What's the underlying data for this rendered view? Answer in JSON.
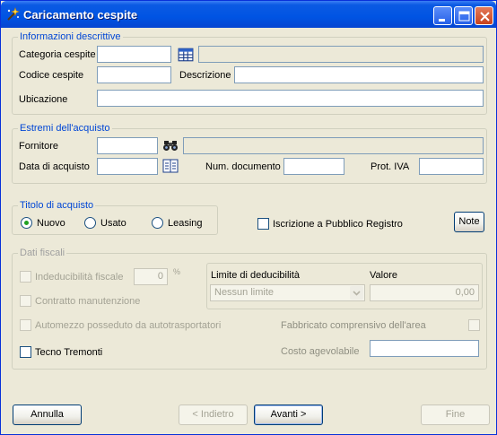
{
  "window": {
    "title": "Caricamento cespite"
  },
  "groups": {
    "informazioni": "Informazioni descrittive",
    "estremi": "Estremi dell'acquisto",
    "titolo": "Titolo di acquisto",
    "dati_fiscali": "Dati fiscali",
    "limite": "Limite di deducibilità"
  },
  "informazioni": {
    "categoria_label": "Categoria cespite",
    "categoria_value": "",
    "codice_label": "Codice cespite",
    "codice_value": "",
    "descrizione_label": "Descrizione",
    "descrizione_value": "",
    "ubicazione_label": "Ubicazione",
    "ubicazione_value": ""
  },
  "estremi": {
    "fornitore_label": "Fornitore",
    "data_label": "Data di acquisto",
    "num_doc_label": "Num. documento",
    "prot_iva_label": "Prot. IVA"
  },
  "titolo": {
    "nuovo": "Nuovo",
    "usato": "Usato",
    "leasing": "Leasing",
    "selected": "Nuovo",
    "pubblico_registro": "Iscrizione a Pubblico Registro",
    "note_button": "Note"
  },
  "fiscali": {
    "indeducibilita": "Indeducibilità fiscale",
    "indeducibilita_value": "0",
    "percent": "%",
    "contratto": "Contratto manutenzione",
    "automezzo": "Automezzo posseduto da autotrasportatori",
    "fabbricato": "Fabbricato comprensivo dell'area",
    "tecno": "Tecno Tremonti",
    "costo": "Costo agevolabile",
    "valore_label": "Valore",
    "limite_selected": "Nessun limite",
    "valore_value": "0,00"
  },
  "buttons": {
    "annulla": "Annulla",
    "indietro": "< Indietro",
    "avanti": "Avanti >",
    "fine": "Fine"
  }
}
